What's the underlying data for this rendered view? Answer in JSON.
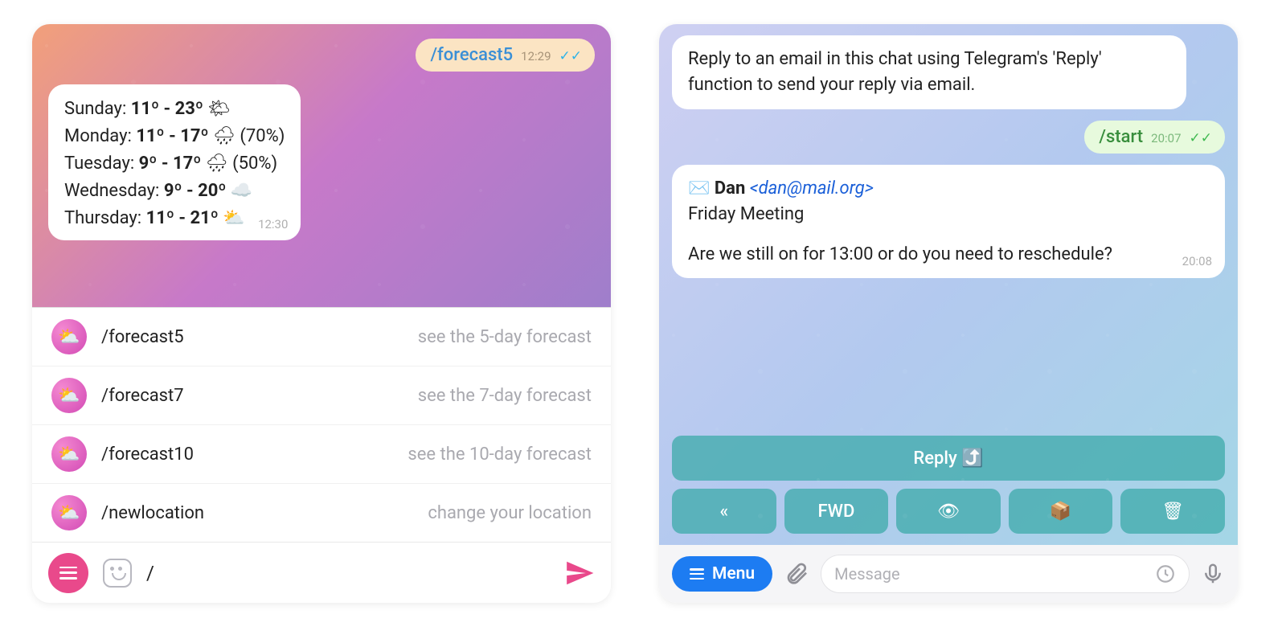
{
  "left": {
    "outgoing": {
      "command": "/forecast5",
      "time": "12:29",
      "status": "read"
    },
    "forecast": {
      "time": "12:30",
      "days": [
        {
          "day": "Sunday",
          "low": "11º",
          "high": "23º",
          "icon": "🌤",
          "extra": ""
        },
        {
          "day": "Monday",
          "low": "11º",
          "high": "17º",
          "icon": "🌧",
          "extra": "(70%)"
        },
        {
          "day": "Tuesday",
          "low": "9º",
          "high": "17º",
          "icon": "🌧",
          "extra": "(50%)"
        },
        {
          "day": "Wednesday",
          "low": "9º",
          "high": "20º",
          "icon": "☁️",
          "extra": ""
        },
        {
          "day": "Thursday",
          "low": "11º",
          "high": "21º",
          "icon": "⛅",
          "extra": ""
        }
      ]
    },
    "commands": [
      {
        "name": "/forecast5",
        "desc": "see the 5-day forecast"
      },
      {
        "name": "/forecast7",
        "desc": "see the 7-day forecast"
      },
      {
        "name": "/forecast10",
        "desc": "see the 10-day forecast"
      },
      {
        "name": "/newlocation",
        "desc": "change your location"
      }
    ],
    "input_value": "/"
  },
  "right": {
    "intro": "Reply to an email in this chat using Telegram's 'Reply' function to send your reply via email.",
    "outgoing": {
      "command": "/start",
      "time": "20:07",
      "status": "read"
    },
    "email": {
      "icon": "✉️",
      "from_name": "Dan",
      "from_addr": "<dan@mail.org>",
      "subject": "Friday Meeting",
      "body": "Are we still on for 13:00 or do you need to reschedule?",
      "time": "20:08"
    },
    "keyboard": {
      "row1": [
        "Reply ⤴️"
      ],
      "row2": [
        "«",
        "FWD",
        "👁",
        "📦",
        "🗑"
      ]
    },
    "menu_label": "Menu",
    "input_placeholder": "Message"
  }
}
